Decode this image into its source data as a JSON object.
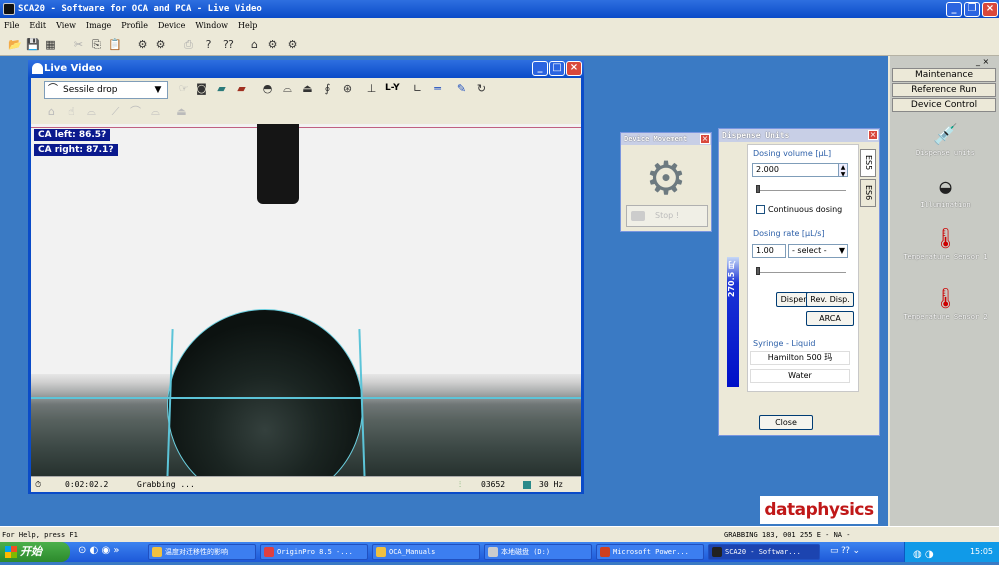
{
  "app": {
    "title": "SCA20 - Software for OCA and PCA - Live Video"
  },
  "menu": [
    "File",
    "Edit",
    "View",
    "Image",
    "Profile",
    "Device",
    "Window",
    "Help"
  ],
  "right_panel": {
    "buttons": [
      "Maintenance",
      "Reference Run",
      "Device Control"
    ],
    "tools": [
      {
        "label": "Dispense units",
        "icon": "syringe-icon"
      },
      {
        "label": "Illumination",
        "icon": "lamp-icon"
      },
      {
        "label": "Temperature Sensor 1",
        "icon": "thermometer-icon"
      },
      {
        "label": "Temperature Sensor 2",
        "icon": "thermometer-icon"
      }
    ]
  },
  "live_video": {
    "title": "Live Video",
    "mode_select": "Sessile drop",
    "ca_left": "CA left:  86.5?",
    "ca_right": "CA right: 87.1?",
    "toolbar_text": "L-Y",
    "status": {
      "time": "0:02:02.2",
      "state": "Grabbing ...",
      "frames": "03652",
      "fps": "30 Hz"
    }
  },
  "device_movement": {
    "title": "Device Movement",
    "stop_label": "Stop !"
  },
  "dispense_units": {
    "title": "Dispense Units",
    "tabs": [
      "ES5",
      "ES6"
    ],
    "dosing_volume_label": "Dosing volume [μL]",
    "dosing_volume_value": "2.000",
    "continuous_label": "Continuous dosing",
    "dosing_rate_label": "Dosing rate [μL/s]",
    "dosing_rate_value": "1.00",
    "rate_select": "- select -",
    "level_label": "270.5 月",
    "dispense_button": "Dispense",
    "rev_disp_button": "Rev. Disp.",
    "arca_button": "ARCA",
    "syringe_label": "Syringe - Liquid",
    "syringe_value": "Hamilton 500 玛",
    "liquid_value": "Water",
    "close_button": "Close"
  },
  "logo": "dataphysics",
  "statusbar": {
    "help": "For Help, press F1",
    "info": "GRABBING 183, 001   255    E  - NA -"
  },
  "taskbar": {
    "start": "开始",
    "items": [
      "温度对迁移性的影响",
      "OriginPro 8.5 -...",
      "OCA_Manuals",
      "本地磁盘 (D:)",
      "Microsoft Power...",
      "SCA20 - Softwar..."
    ],
    "clock": "15:05"
  }
}
